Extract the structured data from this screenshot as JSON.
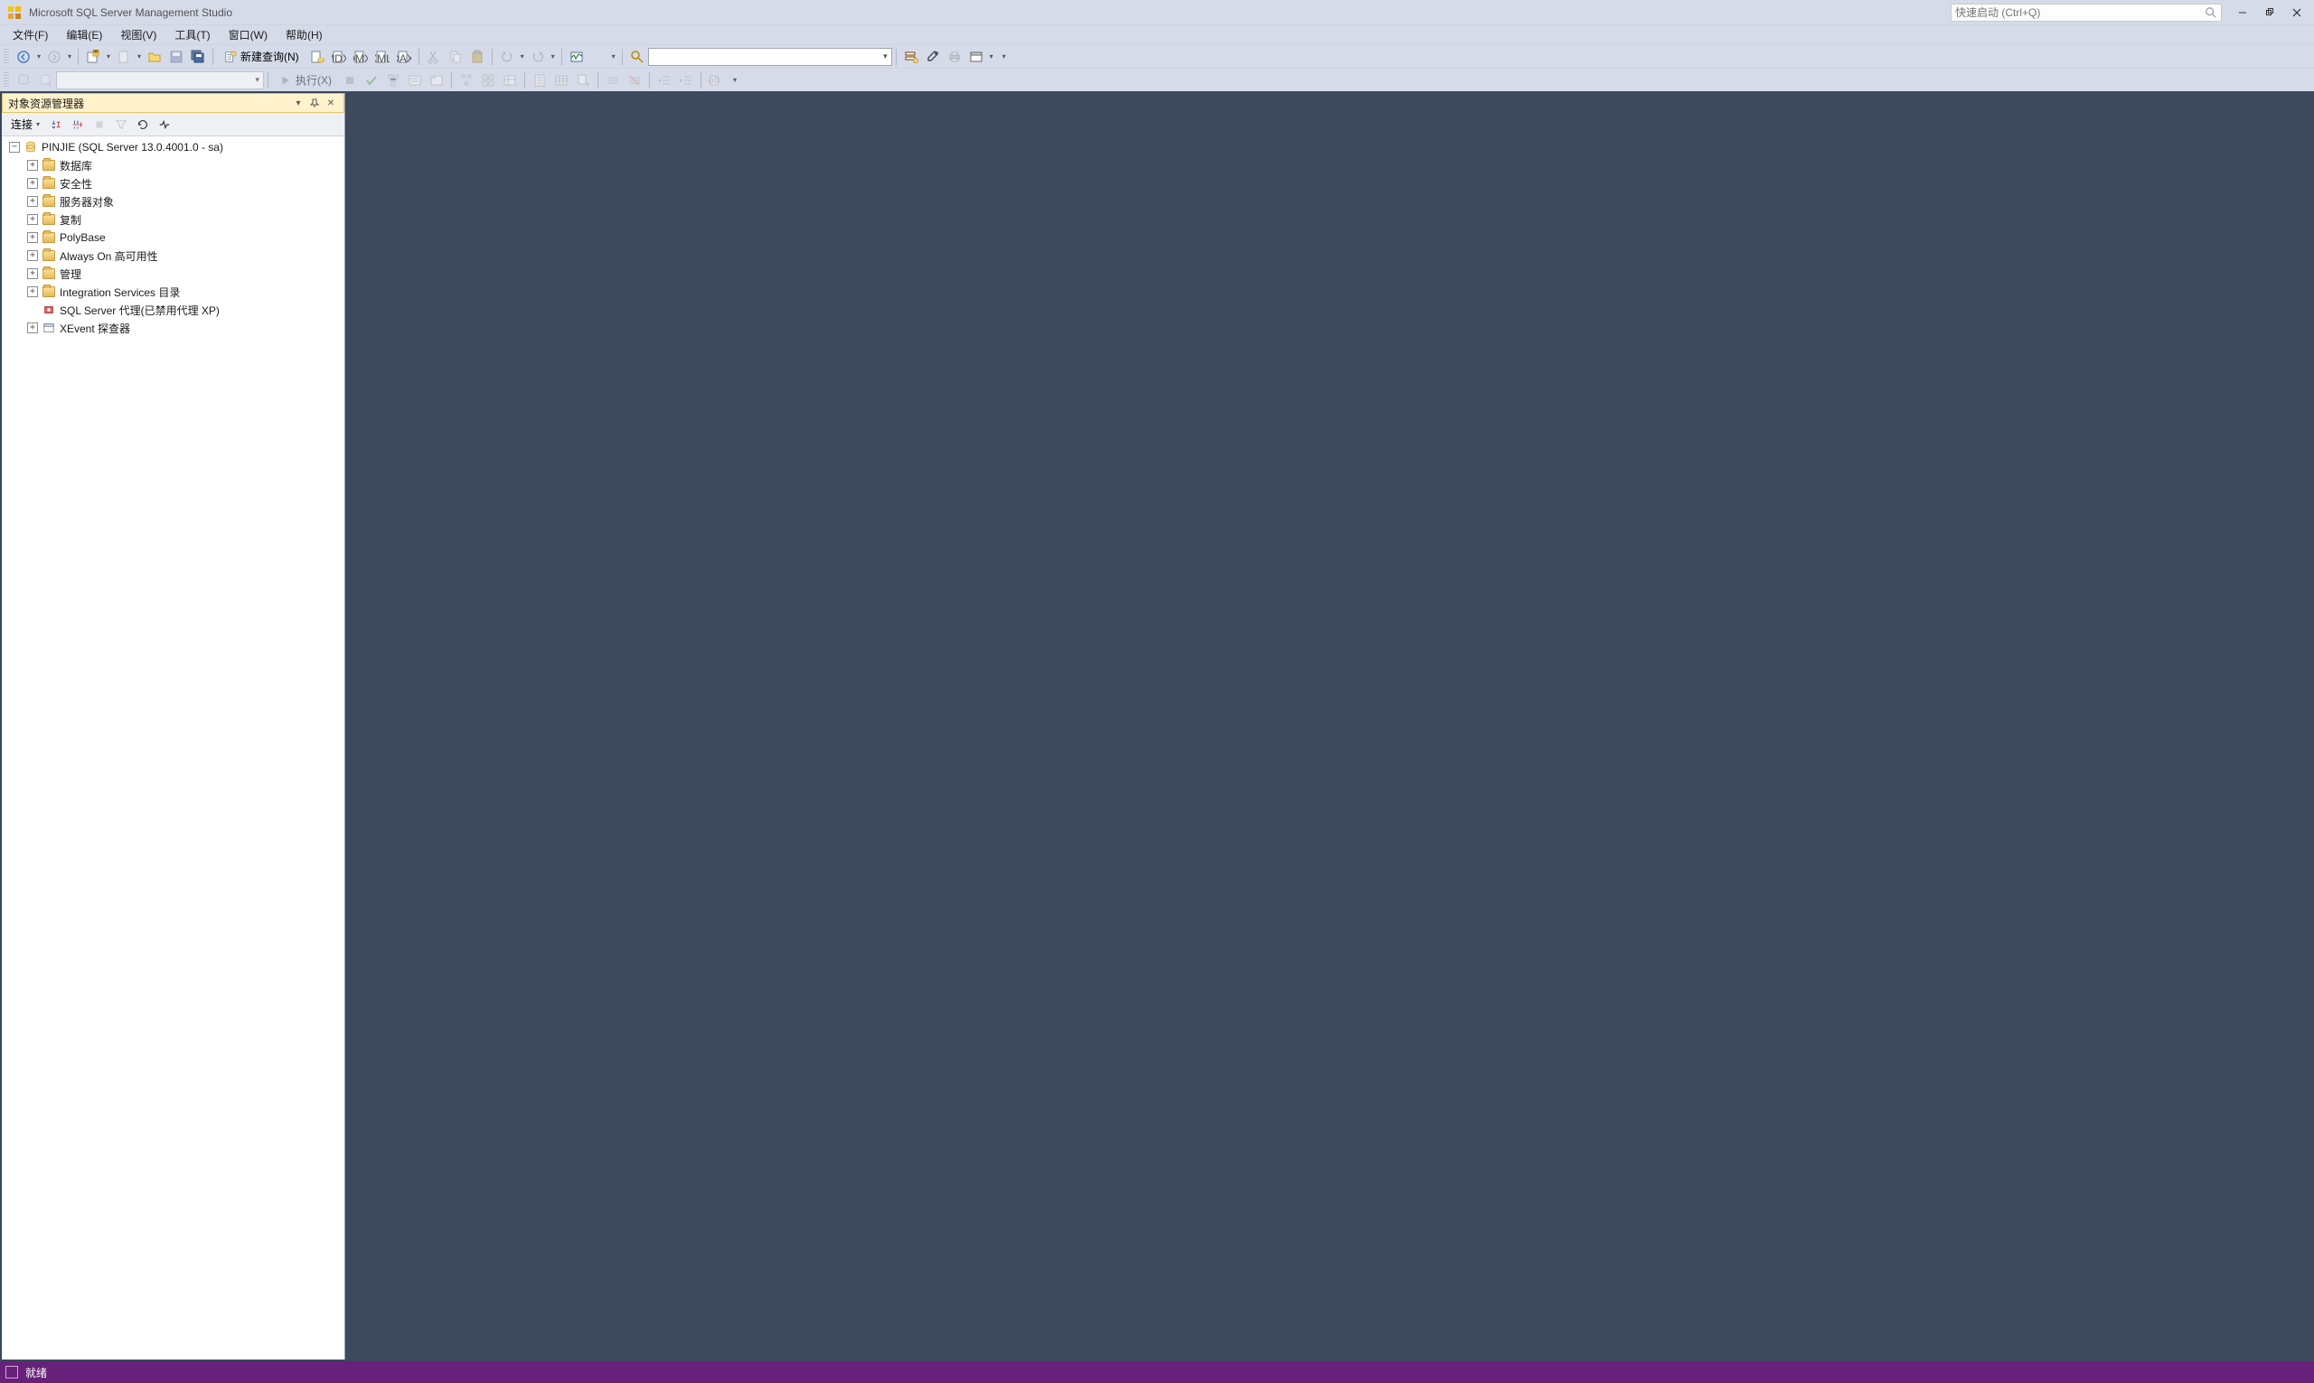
{
  "app": {
    "title": "Microsoft SQL Server Management Studio",
    "quick_launch_placeholder": "快速启动 (Ctrl+Q)"
  },
  "menu": {
    "file": "文件(F)",
    "edit": "编辑(E)",
    "view": "视图(V)",
    "tools": "工具(T)",
    "window": "窗口(W)",
    "help": "帮助(H)"
  },
  "toolbar1": {
    "new_query": "新建查询(N)"
  },
  "toolbar2": {
    "execute": "执行(X)"
  },
  "object_explorer": {
    "title": "对象资源管理器",
    "connect": "连接",
    "root": "PINJIE (SQL Server 13.0.4001.0 - sa)",
    "nodes": {
      "databases": "数据库",
      "security": "安全性",
      "server_objects": "服务器对象",
      "replication": "复制",
      "polybase": "PolyBase",
      "alwayson": "Always On 高可用性",
      "management": "管理",
      "integration_services": "Integration Services 目录",
      "sql_agent": "SQL Server 代理(已禁用代理 XP)",
      "xevent": "XEvent 探查器"
    }
  },
  "statusbar": {
    "ready": "就绪"
  }
}
